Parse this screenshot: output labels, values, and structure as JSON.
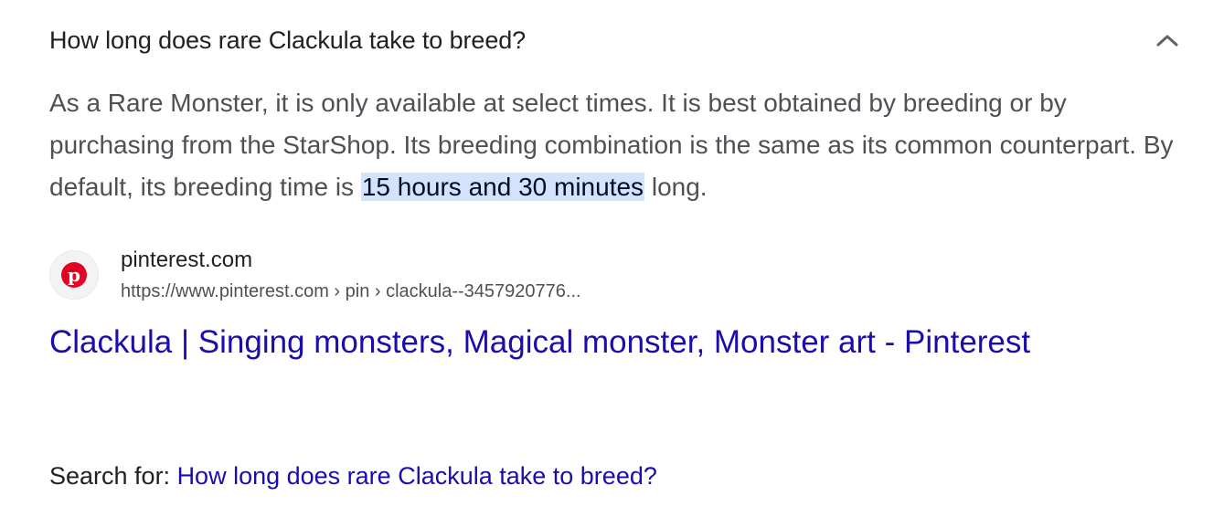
{
  "question": "How long does rare Clackula take to breed?",
  "answer": {
    "text_before": "As a Rare Monster, it is only available at select times. It is best obtained by breeding or by purchasing from the StarShop. Its breeding combination is the same as its common counterpart. By default, its breeding time is ",
    "highlight": "15 hours and 30 minutes",
    "text_after": " long."
  },
  "source": {
    "favicon": "pinterest-icon",
    "site_name": "pinterest.com",
    "url": "https://www.pinterest.com › pin › clackula--3457920776..."
  },
  "result_title": "Clackula | Singing monsters, Magical monster, Monster art - Pinterest",
  "search_for": {
    "label": "Search for: ",
    "query": "How long does rare Clackula take to breed?"
  },
  "colors": {
    "link": "#1a0dab",
    "highlight_bg": "#d3e3fd",
    "pinterest_red": "#e60023"
  }
}
